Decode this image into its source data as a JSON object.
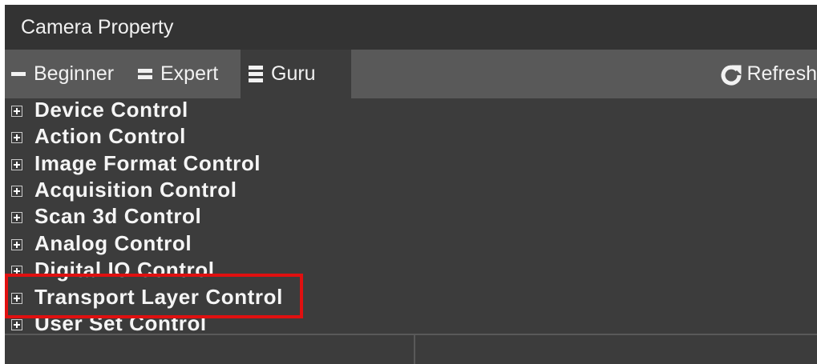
{
  "window": {
    "title": "Camera Property"
  },
  "toolbar": {
    "tabs": [
      {
        "label": "Beginner",
        "icon": "single-bar-icon"
      },
      {
        "label": "Expert",
        "icon": "double-bar-icon"
      },
      {
        "label": "Guru",
        "icon": "triple-bar-icon",
        "selected": true
      }
    ],
    "refresh_label": "Refresh",
    "refresh_icon": "refresh-icon"
  },
  "tree": {
    "items": [
      {
        "label": "Device Control"
      },
      {
        "label": "Action Control"
      },
      {
        "label": "Image Format Control"
      },
      {
        "label": "Acquisition Control"
      },
      {
        "label": "Scan 3d Control"
      },
      {
        "label": "Analog Control"
      },
      {
        "label": "Digital IO Control"
      },
      {
        "label": "Transport Layer Control",
        "highlighted": true
      },
      {
        "label": "User Set Control"
      }
    ]
  },
  "colors": {
    "panel_background": "#3c3c3c",
    "titlebar_background": "#333333",
    "toolbar_background": "#595959",
    "text": "#f5f5f5",
    "highlight_border": "#e01010"
  }
}
